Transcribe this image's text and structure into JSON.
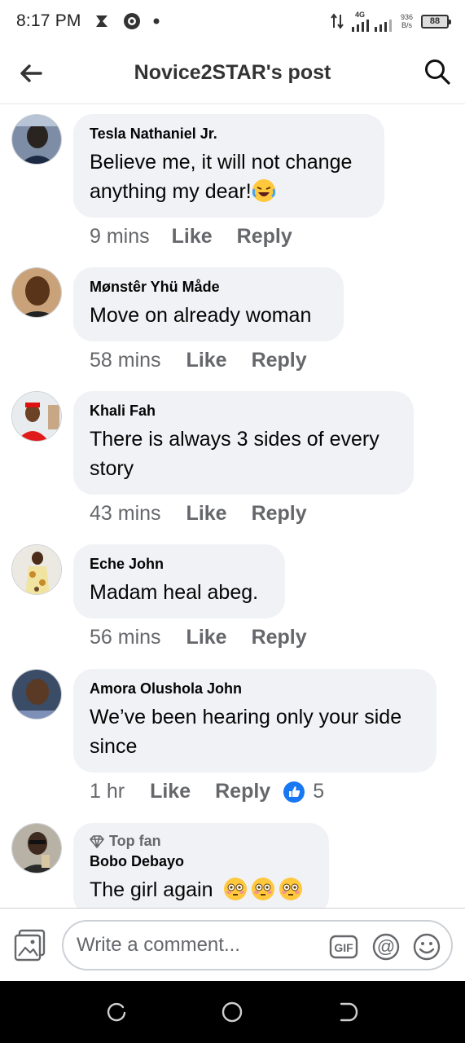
{
  "status_bar": {
    "time": "8:17 PM",
    "signal_label": "4G",
    "net_speed_value": "936",
    "net_speed_unit": "B/s",
    "battery": "88"
  },
  "header": {
    "title": "Novice2STAR's post"
  },
  "comments": [
    {
      "name": "Tesla Nathaniel Jr.",
      "text": "Believe me, it will not change anything my dear!",
      "time": "9 mins",
      "like": "Like",
      "reply": "Reply"
    },
    {
      "name": "Mønstêr Yhü Måde",
      "text": "Move on already woman",
      "time": "58 mins",
      "like": "Like",
      "reply": "Reply"
    },
    {
      "name": "Khali Fah",
      "text": "There is always 3 sides of every story",
      "time": "43 mins",
      "like": "Like",
      "reply": "Reply"
    },
    {
      "name": "Eche John",
      "text": "Madam heal abeg.",
      "time": "56 mins",
      "like": "Like",
      "reply": "Reply"
    },
    {
      "name": "Amora Olushola John",
      "text": "We’ve been hearing only your side since",
      "time": "1 hr",
      "like": "Like",
      "reply": "Reply",
      "reaction_count": "5"
    },
    {
      "badge": "Top fan",
      "name": "Bobo Debayo",
      "text": "The girl again"
    }
  ],
  "composer": {
    "placeholder": "Write a comment..."
  },
  "icons": {
    "back": "arrow-left-icon",
    "search": "search-icon",
    "photo": "photo-icon",
    "gif": "gif-icon",
    "mention": "at-icon",
    "emoji": "emoji-icon",
    "like_reaction": "thumbs-up-icon"
  },
  "colors": {
    "bubble": "#f0f2f5",
    "secondary_text": "#65676b",
    "like_blue": "#1877f2",
    "nav_bar": "#000000"
  }
}
